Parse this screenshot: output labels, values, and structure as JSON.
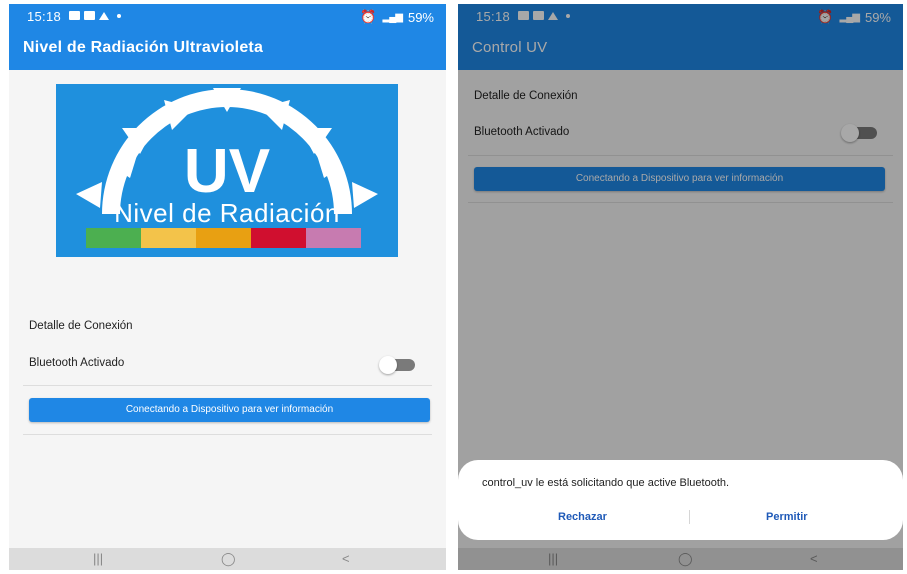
{
  "left_screen": {
    "status": {
      "time": "15:18",
      "battery": "59%"
    },
    "app_title": "Nivel de Radiación Ultravioleta",
    "logo": {
      "uv_text": "UV",
      "subtitle": "Nivel de Radiación",
      "scale_colors": [
        "#4caf50",
        "#f3c34a",
        "#e8a012",
        "#d00f2f",
        "#c77bb0"
      ]
    },
    "connection_detail_label": "Detalle de Conexión",
    "bluetooth_label": "Bluetooth Activado",
    "bluetooth_enabled": false,
    "connect_button": "Conectando a Dispositivo para ver información"
  },
  "right_screen": {
    "status": {
      "time": "15:18",
      "battery": "59%"
    },
    "app_title": "Control UV",
    "connection_detail_label": "Detalle de Conexión",
    "bluetooth_label": "Bluetooth Activado",
    "bluetooth_enabled": false,
    "connect_button": "Conectando a Dispositivo para ver información",
    "dialog": {
      "message": "control_uv le está solicitando que active Bluetooth.",
      "deny_label": "Rechazar",
      "allow_label": "Permitir"
    }
  },
  "nav": {
    "recent": "|||",
    "home": "◯",
    "back": "<"
  },
  "colors": {
    "accent": "#1f87e5",
    "logo_bg": "#1f90dd",
    "dialog_button": "#1f5ab8"
  }
}
